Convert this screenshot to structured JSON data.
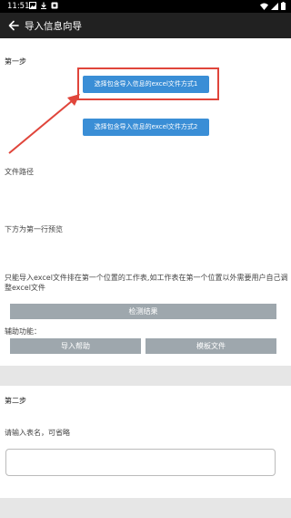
{
  "status_bar": {
    "time": "11:51"
  },
  "app_bar": {
    "title": "导入信息向导"
  },
  "step1": {
    "label": "第一步",
    "option1": "选择包含导入信息的excel文件方式1",
    "option2": "选择包含导入信息的excel文件方式2",
    "file_path_label": "文件路径",
    "preview_label": "下方为第一行预览",
    "notice": "只能导入excel文件排在第一个位置的工作表,如工作表在第一个位置以外需要用户自己调整excel文件",
    "check_button": "检测结果",
    "aux_label": "辅助功能：",
    "help_button": "导入帮助",
    "template_button": "模板文件"
  },
  "step2": {
    "label": "第二步",
    "table_name_hint": "请输入表名，可省略",
    "table_name_value": ""
  },
  "colors": {
    "accent": "#3a8ed6",
    "highlight": "#e0453b",
    "app_bar": "#212121",
    "gray_button": "#9ea7ad"
  }
}
